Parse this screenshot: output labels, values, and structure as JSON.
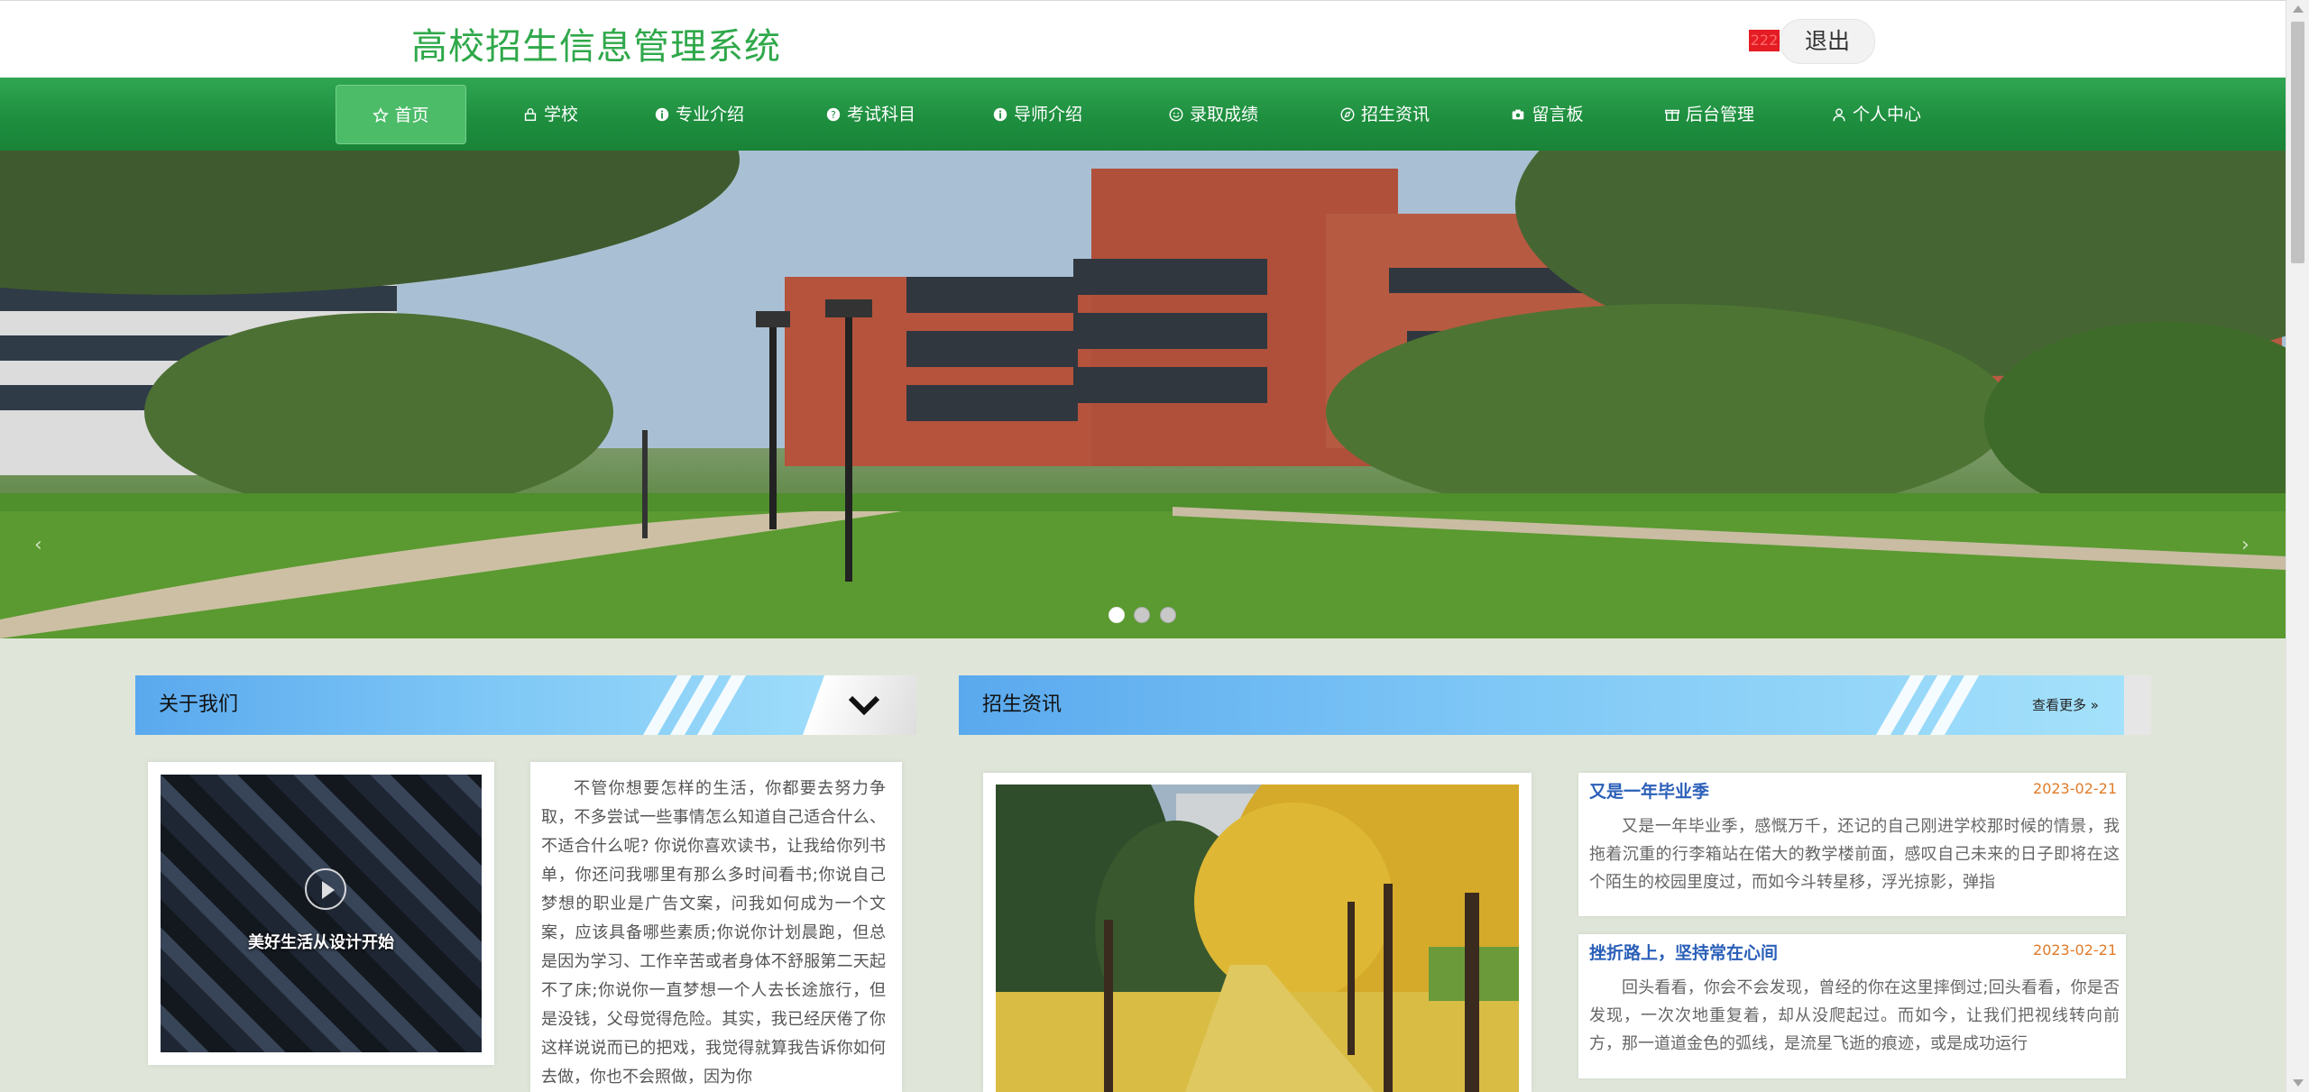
{
  "header": {
    "site_title": "高校招生信息管理系统",
    "user_badge": "222",
    "logout_label": "退出"
  },
  "nav": {
    "items": [
      {
        "label": "首页",
        "icon": "star-icon",
        "active": true
      },
      {
        "label": "学校",
        "icon": "lock-icon"
      },
      {
        "label": "专业介绍",
        "icon": "info-icon"
      },
      {
        "label": "考试科目",
        "icon": "question-icon"
      },
      {
        "label": "导师介绍",
        "icon": "info-icon"
      },
      {
        "label": "录取成绩",
        "icon": "smile-icon"
      },
      {
        "label": "招生资讯",
        "icon": "compass-icon"
      },
      {
        "label": "留言板",
        "icon": "camera-icon"
      },
      {
        "label": "后台管理",
        "icon": "gift-icon"
      },
      {
        "label": "个人中心",
        "icon": "user-icon"
      }
    ]
  },
  "banner": {
    "active_slide": 1,
    "slides": 3
  },
  "about": {
    "title": "关于我们",
    "video_caption": "美好生活从设计开始",
    "text": "不管你想要怎样的生活，你都要去努力争取，不多尝试一些事情怎么知道自己适合什么、不适合什么呢? 你说你喜欢读书，让我给你列书单，你还问我哪里有那么多时间看书;你说自己梦想的职业是广告文案，问我如何成为一个文案，应该具备哪些素质;你说你计划晨跑，但总是因为学习、工作辛苦或者身体不舒服第二天起不了床;你说你一直梦想一个人去长途旅行，但是没钱，父母觉得危险。其实，我已经厌倦了你这样说说而已的把戏，我觉得就算我告诉你如何去做，你也不会照做，因为你"
  },
  "news": {
    "title": "招生资讯",
    "more_label": "查看更多 »",
    "items": [
      {
        "title": "又是一年毕业季",
        "date": "2023-02-21",
        "body": "又是一年毕业季，感慨万千，还记的自己刚进学校那时候的情景，我拖着沉重的行李箱站在偌大的教学楼前面，感叹自己未来的日子即将在这个陌生的校园里度过，而如今斗转星移，浮光掠影，弹指"
      },
      {
        "title": "挫折路上，坚持常在心间",
        "date": "2023-02-21",
        "body": "回头看看，你会不会发现，曾经的你在这里摔倒过;回头看看，你是否发现，一次次地重复着，却从没爬起过。而如今，让我们把视线转向前方，那一道道金色的弧线，是流星飞逝的痕迹，或是成功运行"
      }
    ]
  }
}
